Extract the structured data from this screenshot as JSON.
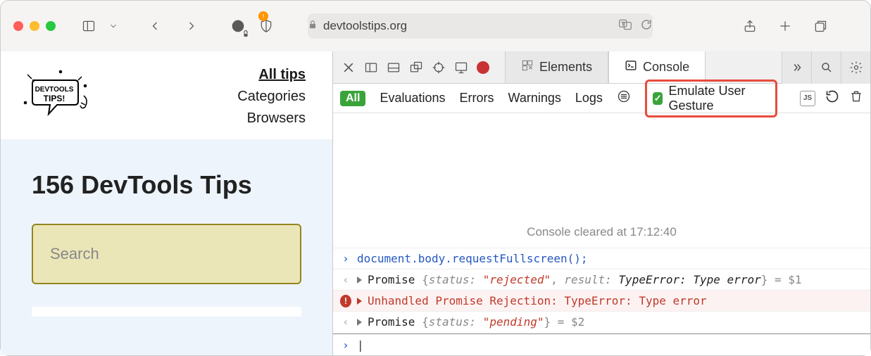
{
  "browser": {
    "url_text": "devtoolstips.org",
    "sidebar_icon": "sidebar-icon",
    "back_icon": "chevron-left-icon",
    "forward_icon": "chevron-right-icon"
  },
  "site": {
    "nav": {
      "all_tips": "All tips",
      "categories": "Categories",
      "browsers": "Browsers"
    },
    "heading": "156 DevTools Tips",
    "search_placeholder": "Search"
  },
  "devtools": {
    "tabs": {
      "elements": "Elements",
      "console": "Console"
    },
    "more_tabs_icon": "chevron-double-right-icon",
    "filters": {
      "all": "All",
      "evaluations": "Evaluations",
      "errors": "Errors",
      "warnings": "Warnings",
      "logs": "Logs",
      "emulate_label": "Emulate User Gesture"
    },
    "cleared_msg": "Console cleared at 17:12:40",
    "lines": {
      "l1": "document.body.requestFullscreen();",
      "l2_prefix": "Promise ",
      "l2_lb": "{",
      "l2_k1": "status: ",
      "l2_v1": "\"rejected\"",
      "l2_sep": ", ",
      "l2_k2": "result: ",
      "l2_v2": "TypeError: Type error",
      "l2_rb": "}",
      "l2_eq": " = $1",
      "l3": "Unhandled Promise Rejection: TypeError: Type error",
      "l4_prefix": "Promise ",
      "l4_lb": "{",
      "l4_k1": "status: ",
      "l4_v1": "\"pending\"",
      "l4_rb": "}",
      "l4_eq": " = $2"
    }
  }
}
